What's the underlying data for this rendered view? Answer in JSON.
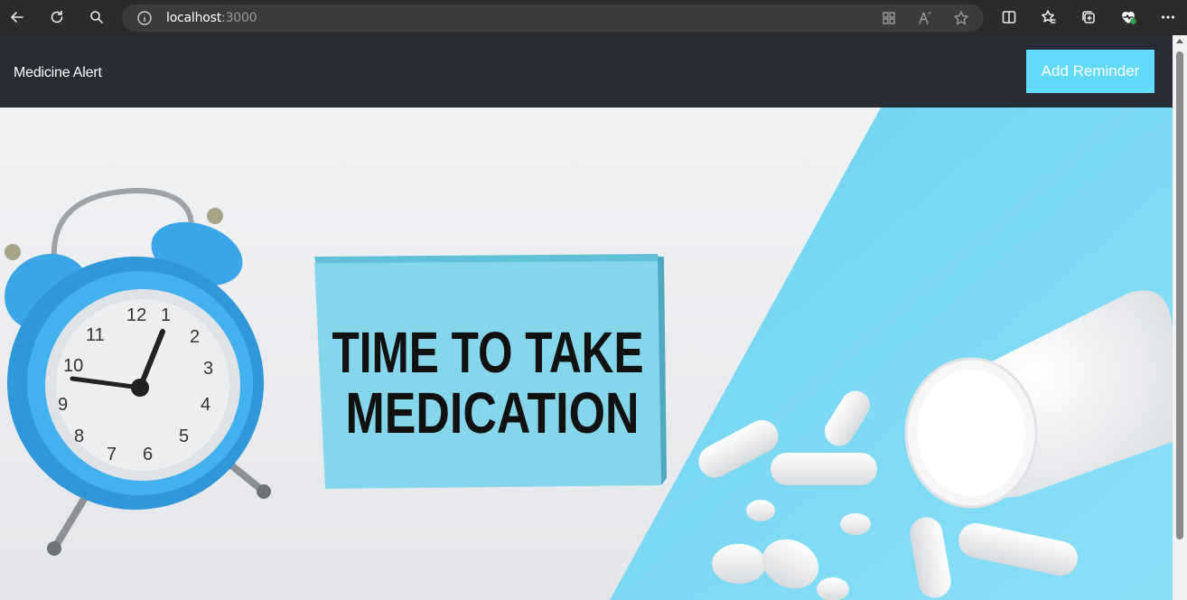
{
  "browser": {
    "url_host": "localhost",
    "url_port": ":3000",
    "icons": [
      "back-icon",
      "refresh-icon",
      "search-icon",
      "info-icon",
      "app-available-icon",
      "read-aloud-icon",
      "favorite-icon",
      "split-screen-icon",
      "favorites-icon",
      "collections-icon",
      "browser-essentials-icon",
      "more-icon"
    ]
  },
  "navbar": {
    "brand": "Medicine Alert",
    "add_reminder_label": "Add Reminder"
  },
  "hero": {
    "sign_line_1": "TIME TO TAKE",
    "sign_line_2": "MEDICATION",
    "clock_numerals": [
      "12",
      "1",
      "2",
      "3",
      "4",
      "5",
      "6",
      "7",
      "8",
      "9",
      "10",
      "11"
    ]
  },
  "colors": {
    "navbar_bg": "#282c34",
    "accent": "#61dafb",
    "hero_blue": "#7dd8f3",
    "clock_blue": "#3aa6e8"
  }
}
